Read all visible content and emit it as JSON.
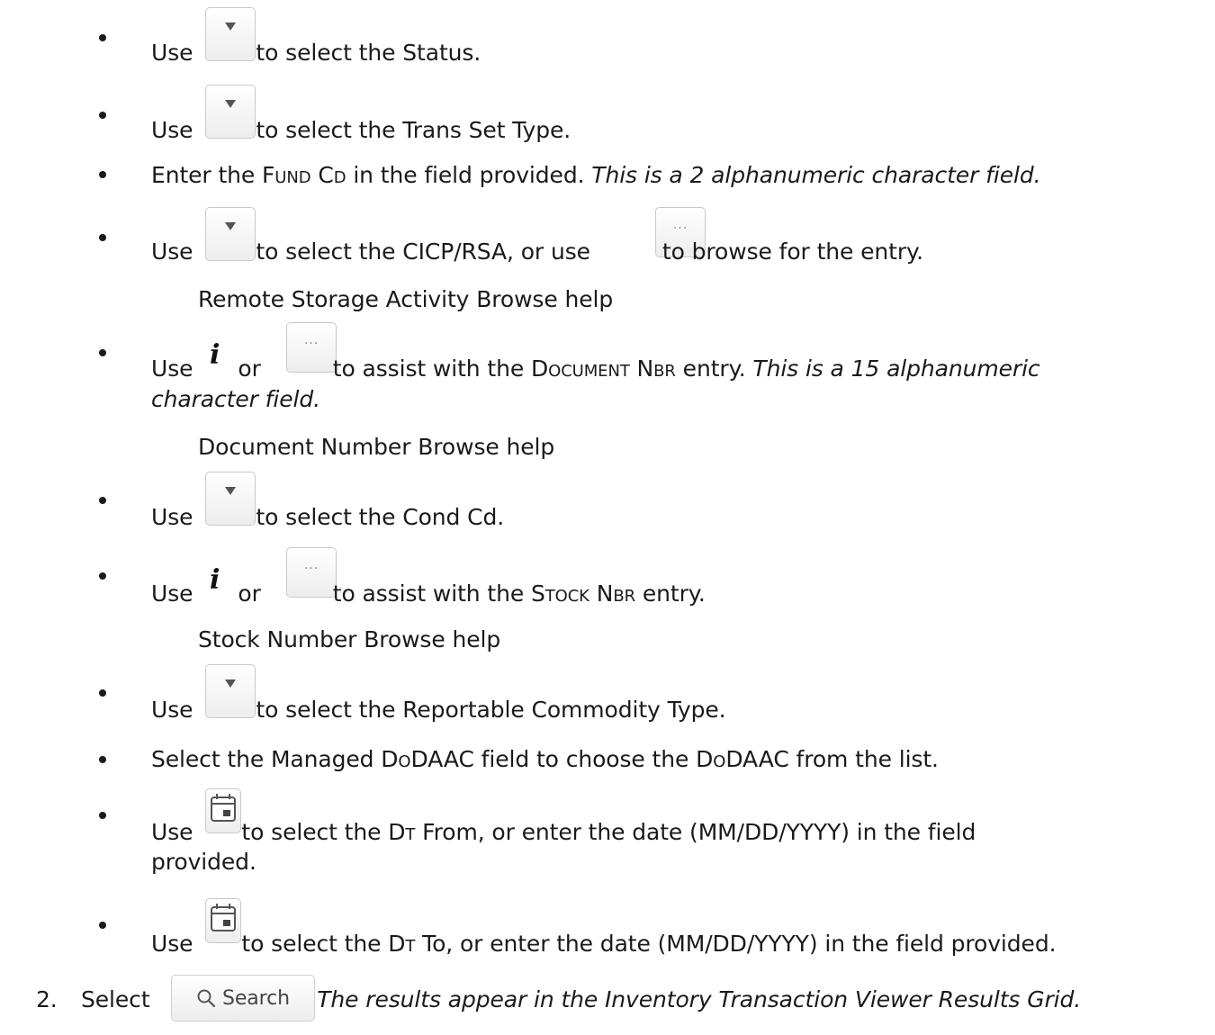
{
  "steps": [
    {
      "type": "bullet",
      "pre": "Use",
      "icon": "dropdown-button",
      "post": "to select the Status."
    },
    {
      "type": "bullet",
      "pre": "Use",
      "icon": "dropdown-button",
      "post": "to select the Trans Set Type."
    },
    {
      "type": "bullet",
      "text_a": "Enter the ",
      "field": "Fund Cd",
      "text_b": " in the field provided. ",
      "note": "This is a 2 alphanumeric character field."
    },
    {
      "type": "bullet",
      "pre": "Use",
      "icon": "dropdown-button",
      "mid": "to select the CICP/RSA, or use",
      "icon2": "browse-button",
      "post": "to browse for the entry.",
      "help": "Remote Storage Activity Browse help"
    },
    {
      "type": "bullet",
      "pre": "Use",
      "icon": "info-button",
      "or": "or",
      "icon2": "browse-button",
      "post_a": "to assist with the ",
      "field": "Document Nbr",
      "post_b": " entry. ",
      "note_a": "This is a 15 alphanumeric",
      "note_b": "character field.",
      "help": "Document Number Browse help"
    },
    {
      "type": "bullet",
      "pre": "Use",
      "icon": "dropdown-button",
      "post": "to select the Cond Cd."
    },
    {
      "type": "bullet",
      "pre": "Use",
      "icon": "info-button",
      "or": "or",
      "icon2": "browse-button",
      "post_a": "to assist with the ",
      "field": "Stock Nbr",
      "post_b": " entry.",
      "help": "Stock Number Browse help"
    },
    {
      "type": "bullet",
      "pre": "Use",
      "icon": "dropdown-button",
      "post": "to select the Reportable Commodity Type."
    },
    {
      "type": "bullet",
      "text_a": "Select the Managed ",
      "field": "DoDAAC",
      "text_b": " field to choose the ",
      "field2": "DoDAAC",
      "text_c": " from the list."
    },
    {
      "type": "bullet",
      "pre": "Use",
      "icon": "calendar-button",
      "post_a": "to select the ",
      "field": "Dt",
      "post_b": " From, or enter the date (MM/DD/YYYY) in the field",
      "post_c": "provided."
    },
    {
      "type": "bullet",
      "pre": "Use",
      "icon": "calendar-button",
      "post_a": "to select the ",
      "field": "Dt",
      "post_b": " To, or enter the date (MM/DD/YYYY) in the field provided."
    }
  ],
  "step2": {
    "number": "2.",
    "pre": "Select",
    "button_label": "Search",
    "post": ". ",
    "note": "The results appear in the Inventory Transaction Viewer Results Grid."
  }
}
